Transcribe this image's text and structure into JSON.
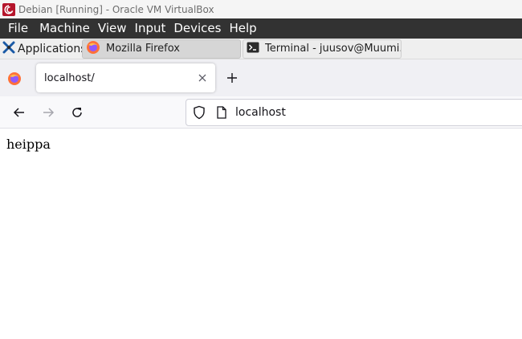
{
  "window": {
    "title": "Debian [Running] - Oracle VM VirtualBox"
  },
  "menu": {
    "items": [
      {
        "label": "File"
      },
      {
        "label": "Machine"
      },
      {
        "label": "View"
      },
      {
        "label": "Input"
      },
      {
        "label": "Devices"
      },
      {
        "label": "Help"
      }
    ]
  },
  "panel": {
    "applications_label": "Applications",
    "tasks": [
      {
        "label": "Mozilla Firefox",
        "icon": "firefox-icon",
        "active": true
      },
      {
        "label": "Terminal - juusov@Muumi...",
        "icon": "terminal-icon",
        "active": false
      }
    ]
  },
  "browser": {
    "tab": {
      "title": "localhost/"
    },
    "url": "localhost"
  },
  "page": {
    "text": "heippa"
  },
  "colors": {
    "menu_bar": "#323232",
    "panel": "#efefef",
    "tabstrip": "#f0f0f4",
    "navbar": "#f9f9fb",
    "vbox_logo": "#b5152b"
  }
}
